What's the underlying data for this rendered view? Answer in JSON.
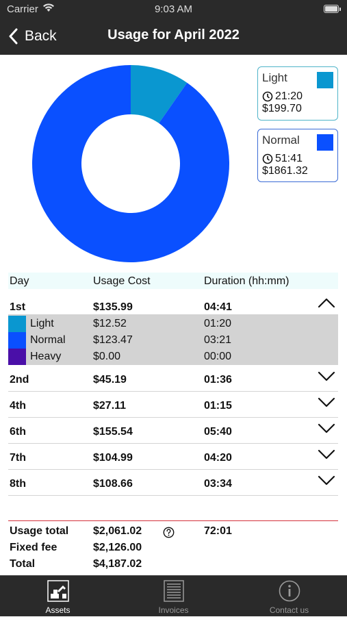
{
  "status": {
    "carrier": "Carrier",
    "time": "9:03 AM"
  },
  "nav": {
    "back_label": "Back",
    "title": "Usage for April 2022"
  },
  "colors": {
    "light": "#0a97d0",
    "normal": "#0a50ff",
    "heavy": "#4a0fa8",
    "accent_red": "#d3303a"
  },
  "chart_data": {
    "type": "pie",
    "subtype": "donut",
    "slices": [
      {
        "name": "Light",
        "duration": "21:20",
        "cost": 199.7,
        "color": "#0a97d0"
      },
      {
        "name": "Normal",
        "duration": "51:41",
        "cost": 1861.32,
        "color": "#0a50ff"
      }
    ]
  },
  "legend": [
    {
      "name": "Light",
      "duration": "21:20",
      "cost": "$199.70",
      "color": "#0a97d0",
      "border": "#4fb4c9"
    },
    {
      "name": "Normal",
      "duration": "51:41",
      "cost": "$1861.32",
      "color": "#0a50ff",
      "border": "#3a6bd6"
    }
  ],
  "table": {
    "headers": {
      "day": "Day",
      "cost": "Usage Cost",
      "duration": "Duration (hh:mm)"
    },
    "expanded": {
      "day": "1st",
      "cost": "$135.99",
      "duration": "04:41",
      "details": [
        {
          "label": "Light",
          "cost": "$12.52",
          "duration": "01:20",
          "color": "#0a97d0"
        },
        {
          "label": "Normal",
          "cost": "$123.47",
          "duration": "03:21",
          "color": "#0a50ff"
        },
        {
          "label": "Heavy",
          "cost": "$0.00",
          "duration": "00:00",
          "color": "#4a0fa8"
        }
      ]
    },
    "rows": [
      {
        "day": "2nd",
        "cost": "$45.19",
        "duration": "01:36"
      },
      {
        "day": "4th",
        "cost": "$27.11",
        "duration": "01:15"
      },
      {
        "day": "6th",
        "cost": "$155.54",
        "duration": "05:40"
      },
      {
        "day": "7th",
        "cost": "$104.99",
        "duration": "04:20"
      },
      {
        "day": "8th",
        "cost": "$108.66",
        "duration": "03:34"
      }
    ]
  },
  "summary": {
    "usage_total_label": "Usage total",
    "usage_total": "$2,061.02",
    "usage_duration": "72:01",
    "fixed_fee_label": "Fixed fee",
    "fixed_fee": "$2,126.00",
    "total_label": "Total",
    "total": "$4,187.02"
  },
  "tabs": [
    {
      "label": "Assets",
      "icon": "assets-icon",
      "active": true
    },
    {
      "label": "Invoices",
      "icon": "invoices-icon",
      "active": false
    },
    {
      "label": "Contact us",
      "icon": "info-icon",
      "active": false
    }
  ]
}
